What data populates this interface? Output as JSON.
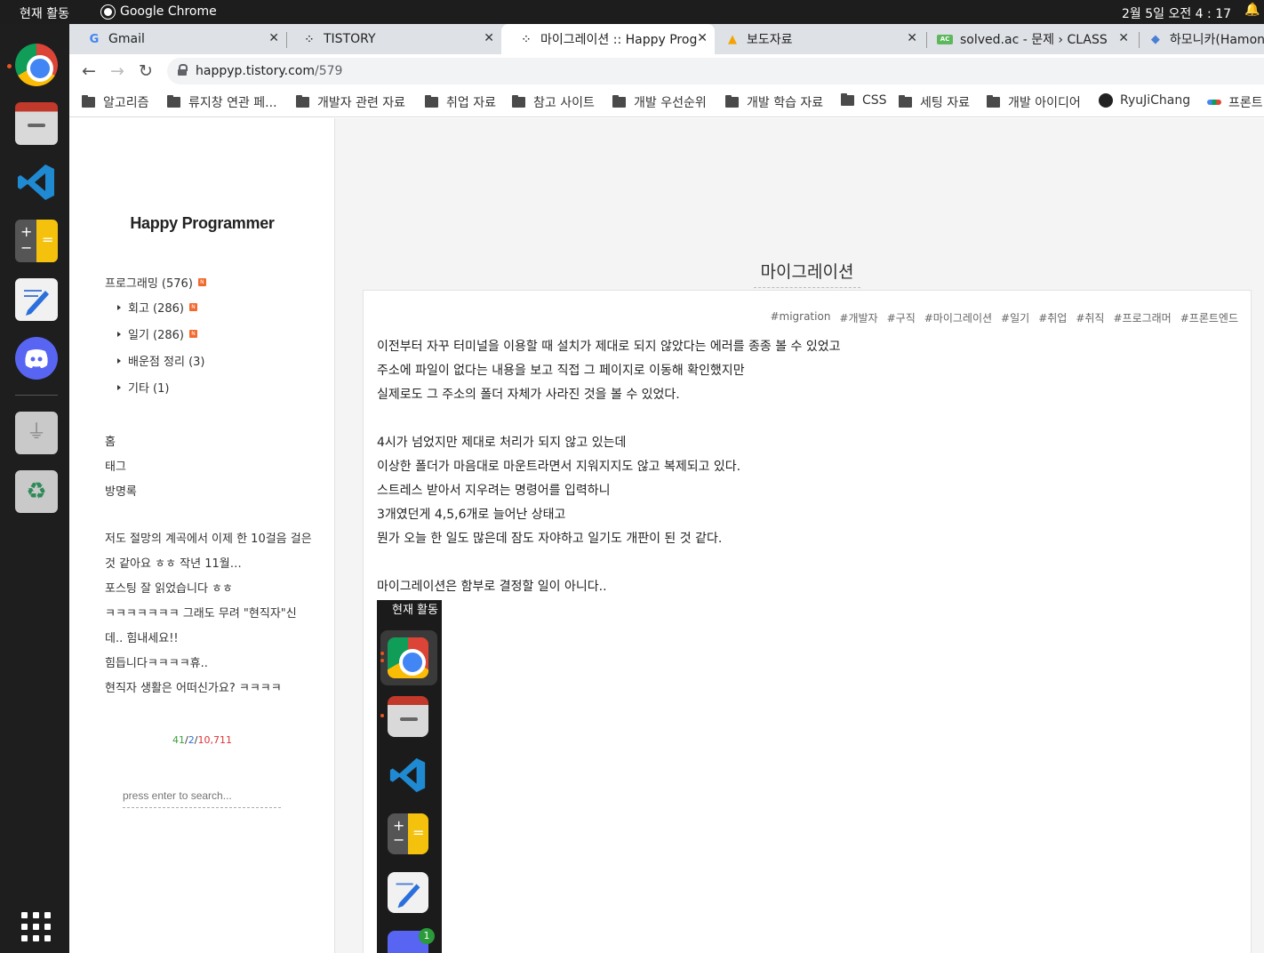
{
  "topbar": {
    "activities": "현재 활동",
    "app_name": "Google Chrome",
    "clock": "2월 5일  오전 4 : 17"
  },
  "tabs": [
    {
      "title": "Gmail",
      "icon": "gmail-icon"
    },
    {
      "title": "TISTORY",
      "icon": "tistory-icon"
    },
    {
      "title": "마이그레이션 :: Happy Prog",
      "icon": "tistory-icon",
      "active": true
    },
    {
      "title": "보도자료",
      "icon": "warning-icon"
    },
    {
      "title": "solved.ac - 문제 › CLASS",
      "icon": "solvedac-icon"
    },
    {
      "title": "하모니카(Hamon",
      "icon": "hamonica-icon"
    }
  ],
  "address": {
    "host": "happyp.tistory.com",
    "path": "/579"
  },
  "bookmarks": [
    "알고리즘",
    "류지창 연관 페...",
    "개발자 관련 자료",
    "취업 자료",
    "참고 사이트",
    "개발 우선순위",
    "개발 학습 자료",
    "CSS",
    "세팅 자료",
    "개발 아이디어",
    "RyuJiChang",
    "프론트"
  ],
  "sidebar": {
    "blog_title": "Happy Programmer",
    "categories": [
      {
        "label": "프로그래밍 (576)"
      },
      {
        "label": "회고 (286)"
      },
      {
        "label": "일기 (286)"
      },
      {
        "label": "배운점 정리 (3)"
      },
      {
        "label": "기타 (1)"
      }
    ],
    "new_badge": "N",
    "links": [
      "홈",
      "태그",
      "방명록"
    ],
    "comments": [
      "저도 절망의 계곡에서 이제 한 10걸음 걸은 것 같아요 ㅎㅎ 작년 11월…",
      "포스팅 잘 읽었습니다 ㅎㅎ",
      "ㅋㅋㅋㅋㅋㅋㅋ 그래도 무려 \"현직자\"신데.. 힘내세요!!",
      "힘듭니다ㅋㅋㅋㅋ휴..",
      "현직자 생활은 어떠신가요? ㅋㅋㅋㅋ"
    ],
    "counter": {
      "today": "41",
      "yesterday": "2",
      "total": "10,711",
      "sep": "/"
    },
    "search_placeholder": "press enter to search..."
  },
  "post": {
    "title": "마이그레이션",
    "tags": [
      "#migration",
      "#개발자",
      "#구직",
      "#마이그레이션",
      "#일기",
      "#취업",
      "#취직",
      "#프로그래머",
      "#프론트엔드"
    ],
    "lines": [
      "이전부터 자꾸 터미널을 이용할 때 설치가 제대로 되지 않았다는 에러를 종종 볼 수 있었고",
      "주소에 파일이 없다는 내용을 보고 직접 그 페이지로 이동해 확인했지만",
      "실제로도 그 주소의 폴더 자체가 사라진 것을 볼 수 있었다.",
      "4시가 넘었지만 제대로 처리가 되지 않고 있는데",
      "이상한 폴더가 마음대로 마운트라면서 지워지지도 않고 복제되고 있다.",
      "스트레스 받아서 지우려는 명령어를 입력하니",
      "3개였던게 4,5,6개로 늘어난 상태고",
      "뭔가 오늘 한 일도 많은데 잠도 자야하고 일기도 개판이 된 것 같다.",
      "마이그레이션은 함부로 결정할 일이 아니다.."
    ],
    "screenshot": {
      "label": "현재 활동",
      "badge": "1"
    }
  }
}
